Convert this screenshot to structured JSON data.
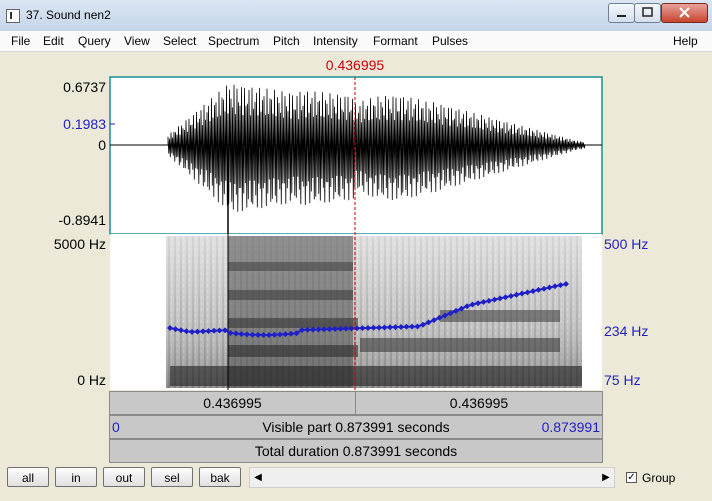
{
  "window": {
    "title": "37. Sound nen2"
  },
  "menu": [
    "File",
    "Edit",
    "Query",
    "View",
    "Select",
    "Spectrum",
    "Pitch",
    "Intensity",
    "Formant",
    "Pulses",
    "Help"
  ],
  "cursor": {
    "time_top": "0.436995"
  },
  "waveform": {
    "max": "0.6737",
    "level": "0.1983",
    "zero": "0",
    "min": "-0.8941"
  },
  "spectrogram": {
    "freq_top": "5000 Hz",
    "freq_bottom": "0 Hz",
    "pitch_top": "500 Hz",
    "pitch_mid": "234 Hz",
    "pitch_bottom": "75 Hz"
  },
  "bars": {
    "left_segment": "0.436995",
    "right_segment": "0.436995",
    "visible_start": "0",
    "visible_label": "Visible part 0.873991 seconds",
    "visible_end": "0.873991",
    "total_label": "Total duration 0.873991 seconds"
  },
  "toolbar": {
    "buttons": [
      "all",
      "in",
      "out",
      "sel",
      "bak"
    ],
    "group_label": "Group",
    "group_checked": true
  }
}
